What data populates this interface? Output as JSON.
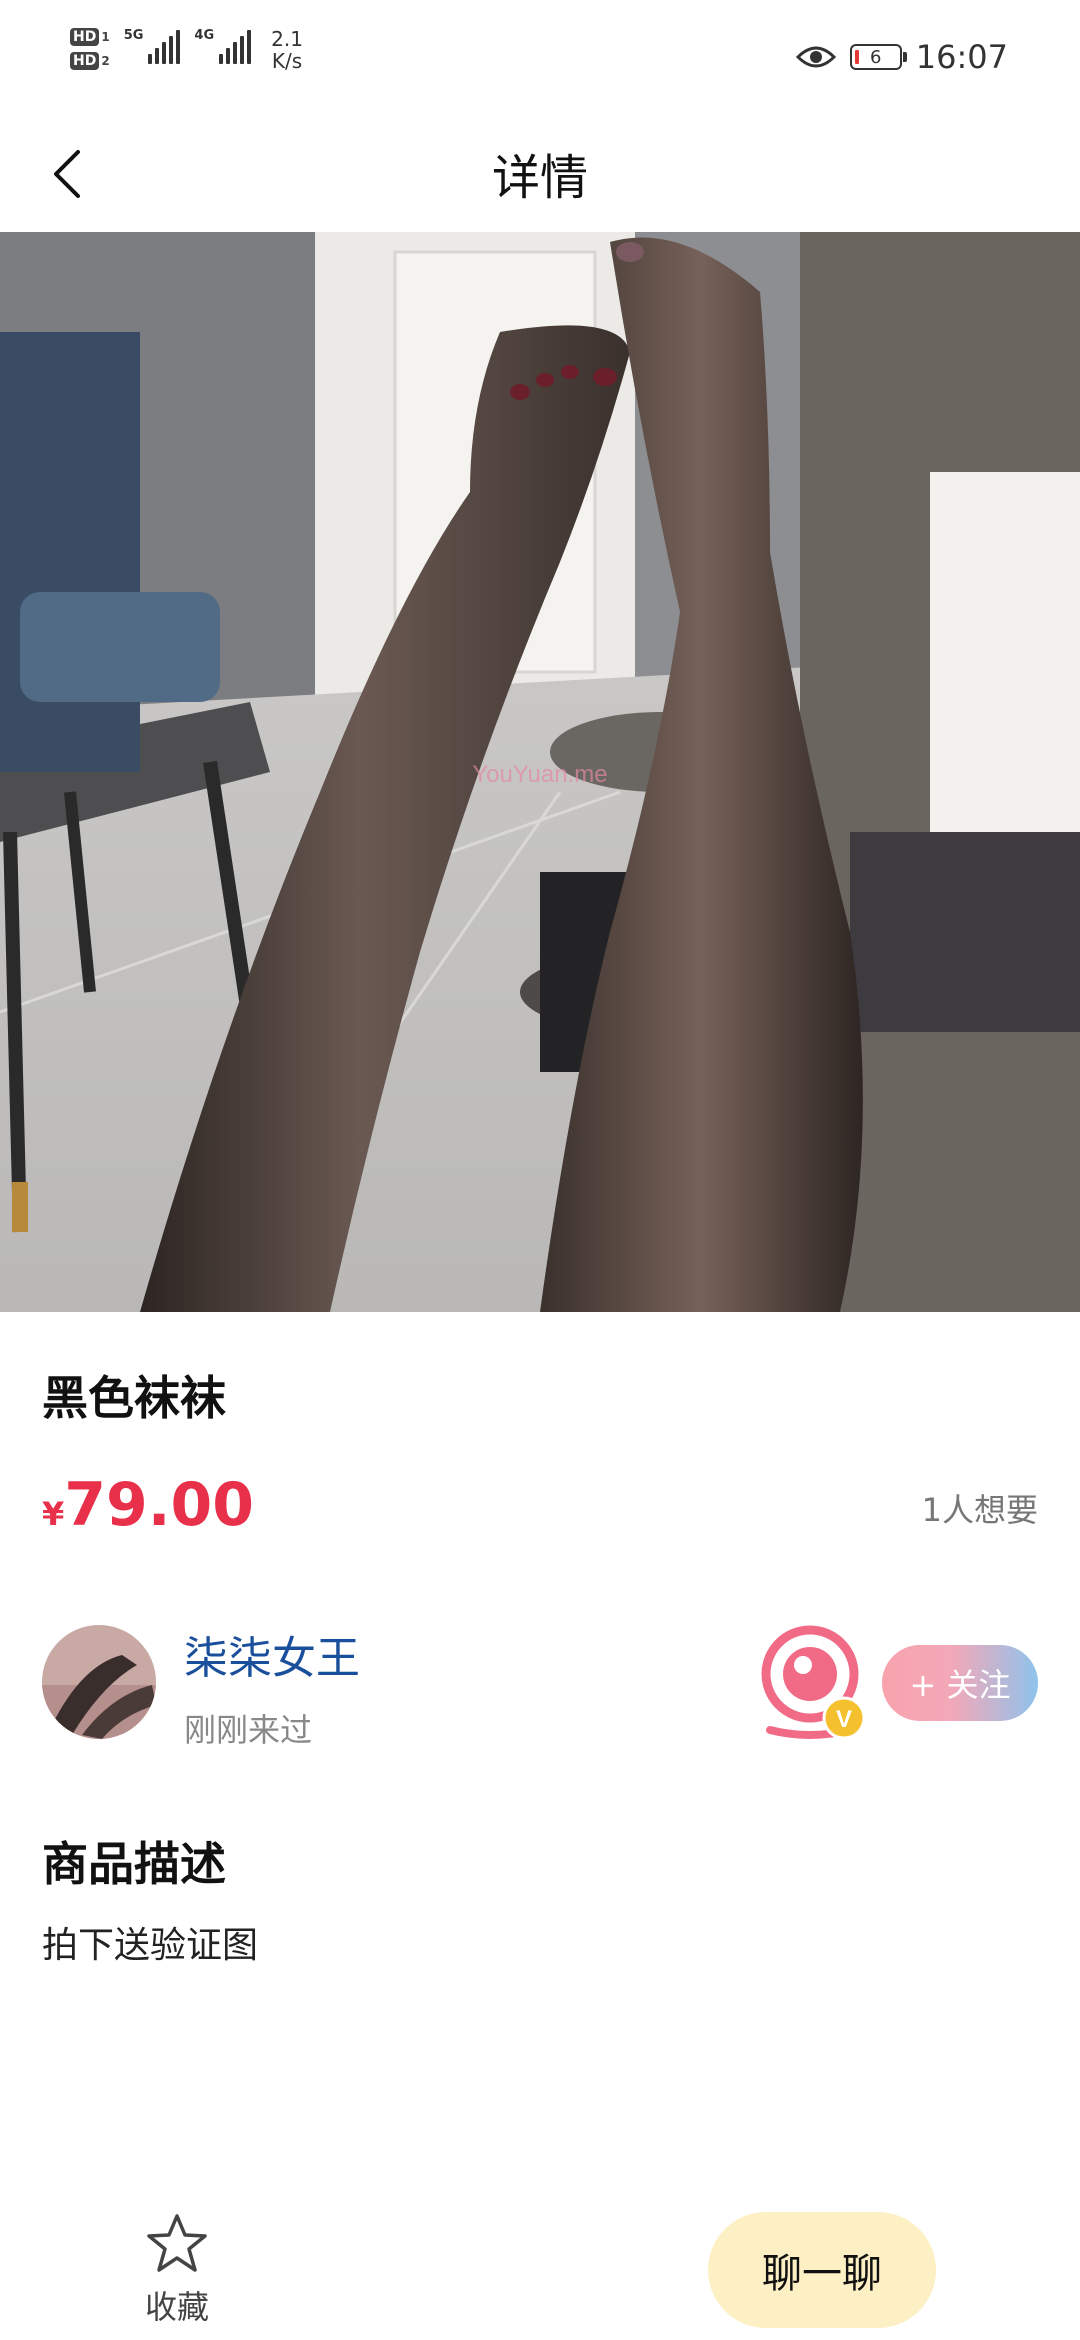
{
  "status_bar": {
    "hd1": "HD",
    "hd1_sub": "1",
    "hd2": "HD",
    "hd2_sub": "2",
    "net1": "5G",
    "net2": "4G",
    "speed_value": "2.1",
    "speed_unit": "K/s",
    "battery": "6",
    "time": "16:07",
    "icons": [
      "eye-icon",
      "battery-icon"
    ]
  },
  "header": {
    "title": "详情",
    "back_icon": "chevron-left-icon"
  },
  "photo": {
    "watermark": "YouYuan.me"
  },
  "product": {
    "title": "黑色袜袜",
    "currency": "¥",
    "price": "79.00",
    "want_count": "1人想要"
  },
  "seller": {
    "name": "柒柒女王",
    "status": "刚刚来过",
    "badge_icon": "webcam-verified-icon",
    "badge_letter": "V",
    "follow_label": "+ 关注"
  },
  "description": {
    "heading": "商品描述",
    "text": "拍下送验证图"
  },
  "bottom_bar": {
    "favorite_label": "收藏",
    "favorite_icon": "star-icon",
    "chat_label": "聊一聊"
  },
  "colors": {
    "price": "#e8304a",
    "seller_name": "#1a4f9c",
    "chat_button_bg": "#fdf0c4"
  }
}
